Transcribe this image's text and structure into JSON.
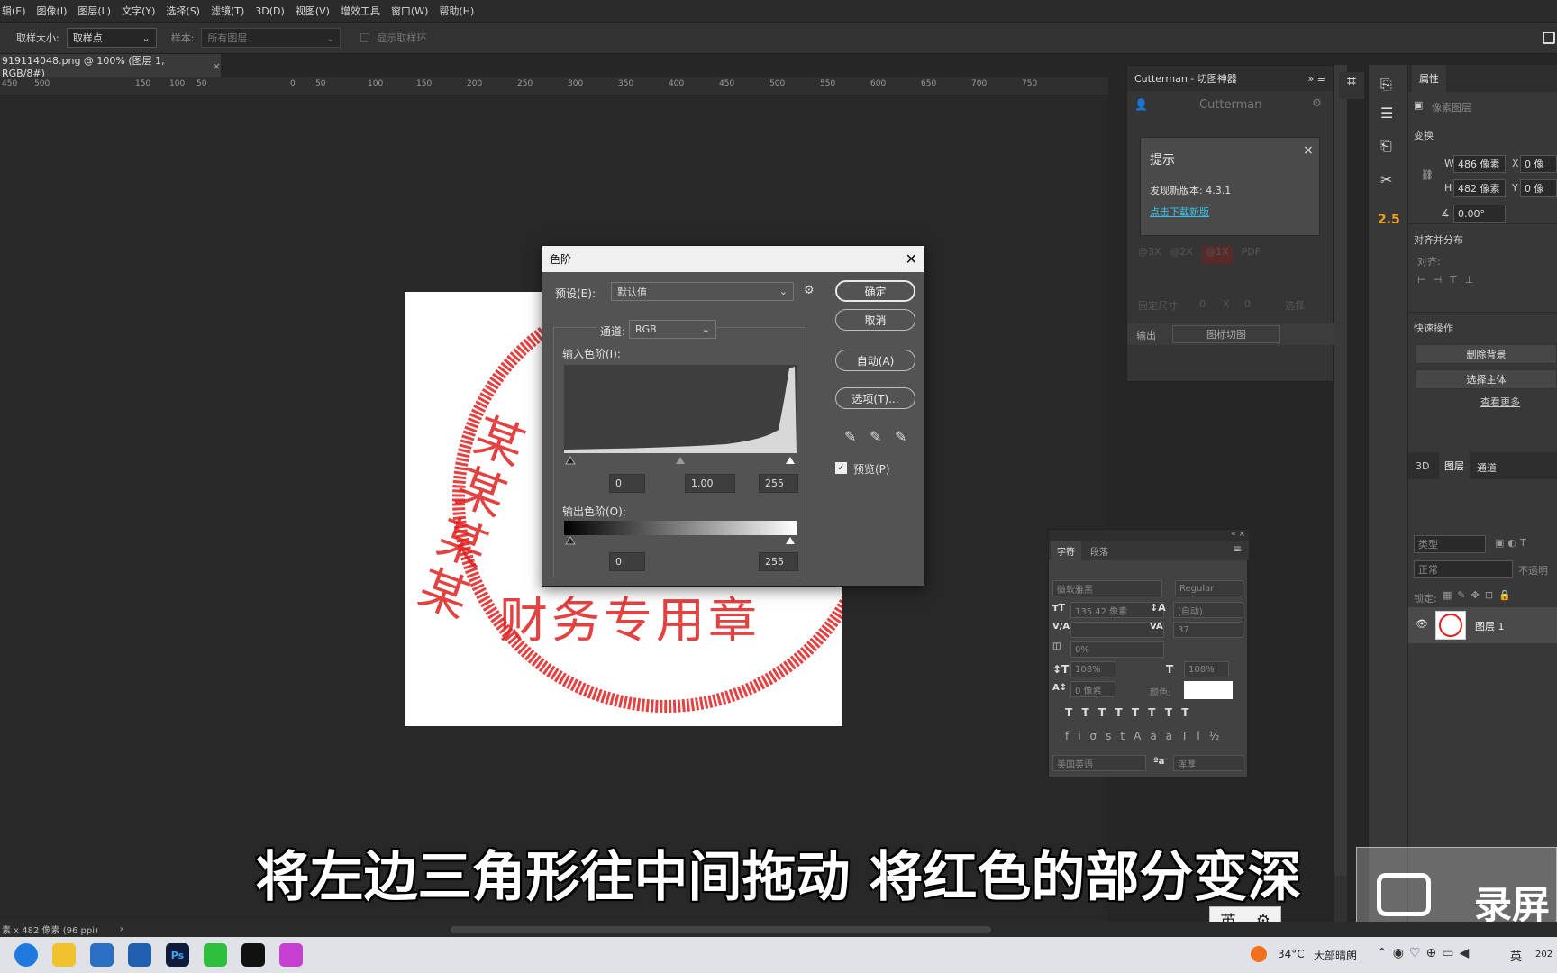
{
  "menu": [
    "辑(E)",
    "图像(I)",
    "图层(L)",
    "文字(Y)",
    "选择(S)",
    "滤镜(T)",
    "3D(D)",
    "视图(V)",
    "增效工具",
    "窗口(W)",
    "帮助(H)"
  ],
  "options": {
    "sample_size_label": "取样大小:",
    "sample_size_value": "取样点",
    "sample_label": "样本:",
    "sample_value": "所有图层",
    "show_ring": "显示取样环"
  },
  "doc_tab": "919114048.png @ 100% (图层 1, RGB/8#)",
  "ruler_ticks": [
    "450",
    "500",
    "150",
    "100",
    "50",
    "0",
    "50",
    "100",
    "150",
    "200",
    "250",
    "300",
    "350",
    "400",
    "450",
    "500",
    "550",
    "600",
    "650",
    "700",
    "750"
  ],
  "stamp": {
    "vertical": "某某某某",
    "bottom": "财务专用章"
  },
  "levels": {
    "title": "色阶",
    "preset_label": "预设(E):",
    "preset_value": "默认值",
    "channel_label": "通道:",
    "channel_value": "RGB",
    "input_label": "输入色阶(I):",
    "input_black": "0",
    "input_gamma": "1.00",
    "input_white": "255",
    "output_label": "输出色阶(O):",
    "output_black": "0",
    "output_white": "255",
    "ok": "确定",
    "cancel": "取消",
    "auto": "自动(A)",
    "options": "选项(T)...",
    "preview": "预览(P)"
  },
  "cutterman": {
    "header": "Cutterman - 切图神器",
    "brand": "Cutterman",
    "tip_title": "提示",
    "tip_msg": "发现新版本: 4.3.1",
    "tip_link": "点击下载新版",
    "scales": [
      "@3X",
      "@2X",
      "@1X",
      "PDF"
    ],
    "fixed_size": "固定尺寸",
    "output": "输出",
    "icon_cut": "图标切图",
    "x": "X",
    "zero": "0",
    "clear": "选择"
  },
  "properties": {
    "tab": "属性",
    "pixel_layer": "像素图层",
    "transform": "变换",
    "w_label": "W",
    "w_value": "486 像素",
    "h_label": "H",
    "h_value": "482 像素",
    "x_label": "X",
    "x_value": "0 像",
    "y_label": "Y",
    "y_value": "0 像",
    "angle": "0.00°",
    "align": "对齐并分布",
    "align_sub": "对齐:",
    "quick": "快速操作",
    "remove_bg": "删除背景",
    "select_subject": "选择主体",
    "more": "查看更多"
  },
  "layers": {
    "tabs": [
      "3D",
      "图层",
      "通道"
    ],
    "kind": "类型",
    "mode": "正常",
    "opacity": "不透明",
    "lock": "锁定:",
    "layer_name": "图层 1"
  },
  "character": {
    "tabs": [
      "字符",
      "段落"
    ],
    "font": "微软雅黑",
    "style": "Regular",
    "size": "135.42 像素",
    "leading": "(自动)",
    "tracking": "37",
    "scale_v": "108%",
    "scale_h": "108%",
    "baseline": "0 像素",
    "color_label": "颜色:",
    "lang": "美国英语",
    "aa": "浑厚",
    "vert": "0%"
  },
  "toolbar_badge": "2.5",
  "subtitle": "将左边三角形往中间拖动 将红色的部分变深",
  "status": "素 x 482 像素 (96 ppi)",
  "recorder": "录屏",
  "ime": "英",
  "weather": {
    "temp": "34°C",
    "desc": "大部晴朗"
  },
  "tray_lang": "英",
  "clock_frag": "202"
}
